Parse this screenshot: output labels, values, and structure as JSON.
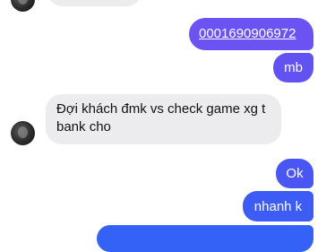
{
  "messages": [
    {
      "side": "in",
      "text": ""
    },
    {
      "side": "out",
      "text": "0001690906972",
      "is_link": true
    },
    {
      "side": "out",
      "text": "mb"
    },
    {
      "side": "in",
      "text": "Đợi khách đmk vs check game xg t bank cho"
    },
    {
      "side": "out",
      "text": "Ok"
    },
    {
      "side": "out",
      "text": "nhanh k"
    },
    {
      "side": "out",
      "text": ""
    }
  ],
  "colors": {
    "incoming_bubble": "#ececee",
    "outgoing_top": "#6a53f2",
    "outgoing_bottom": "#3461f6",
    "background": "#ffffff"
  }
}
